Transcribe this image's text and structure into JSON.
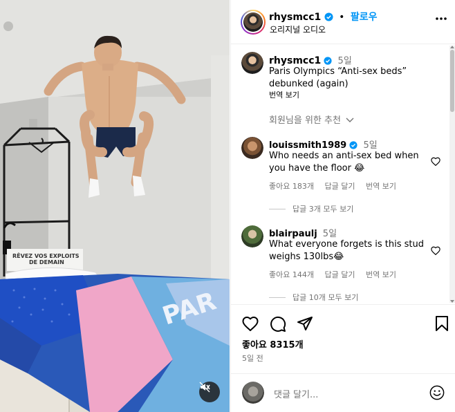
{
  "post": {
    "author": "rhysmcc1",
    "header_dot": "•",
    "follow_label": "팔로우",
    "audio_label": "오리지널 오디오",
    "caption_time": "5일",
    "caption_line1": "Paris Olympics “Anti-sex beds”",
    "caption_line2": "debunked (again)",
    "translate_label": "번역 보기",
    "recommend_label": "회원님을 위한 추천",
    "media_bed_text_line1": "RÊVEZ VOS EXPLOITS",
    "media_bed_text_line2": "DE DEMAIN",
    "media_comforter_text": "PAR"
  },
  "comments": [
    {
      "user": "louissmith1989",
      "time": "5일",
      "verified": true,
      "line1": "Who needs an anti-sex bed when",
      "line2": "you have the floor 😂",
      "likes": "좋아요 183개",
      "reply_label": "답글 달기",
      "translate_label": "번역 보기",
      "view_replies": "답글 3개 모두 보기"
    },
    {
      "user": "blairpaulj",
      "time": "5일",
      "verified": false,
      "line1": "What everyone forgets is this stud",
      "line2": "weighs 130lbs😂",
      "likes": "좋아요 144개",
      "reply_label": "답글 달기",
      "translate_label": "번역 보기",
      "view_replies": "답글 10개 모두 보기"
    }
  ],
  "actions": {
    "likes": "좋아요 8315개",
    "date": "5일 전"
  },
  "composer": {
    "placeholder": "댓글 달기..."
  },
  "colors": {
    "link_blue": "#0095f6",
    "muted": "#737373",
    "verified_blue": "#0095f6"
  },
  "icons": [
    "verified-badge-icon",
    "more-options-icon",
    "heart-icon",
    "comment-icon",
    "share-icon",
    "bookmark-icon",
    "chevron-down-icon",
    "emoji-icon",
    "mute-icon"
  ]
}
